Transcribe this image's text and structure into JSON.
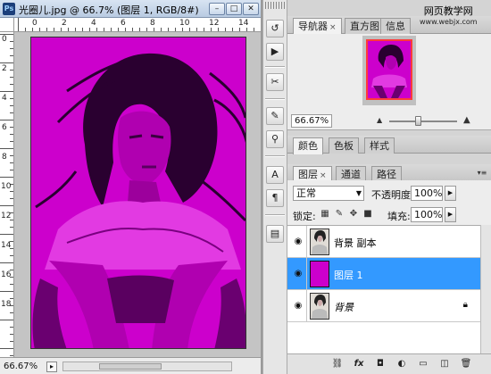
{
  "document": {
    "title": "光圈儿.jpg @ 66.7% (图层 1, RGB/8#)",
    "app_icon": "Ps",
    "zoom": "66.67%",
    "ruler_top": [
      "0",
      "2",
      "4",
      "6",
      "8",
      "10",
      "12",
      "14"
    ],
    "ruler_left": [
      "0",
      "2",
      "4",
      "6",
      "8",
      "10",
      "12",
      "14",
      "16",
      "18"
    ],
    "image_color": "#cc00cc"
  },
  "icons": {
    "minimize": "–",
    "maximize": "□",
    "close": "✕",
    "strip": [
      "history-icon",
      "actions-icon",
      "tool-presets-icon",
      "brushes-icon",
      "clone-source-icon",
      "character-icon",
      "paragraph-icon",
      "layer-comps-icon"
    ]
  },
  "navigator_group": {
    "tabs": [
      "导航器",
      "直方图",
      "信息"
    ],
    "close_mark": "×",
    "zoom_value": "66.67%"
  },
  "color_group": {
    "tabs": [
      "颜色",
      "色板",
      "样式"
    ]
  },
  "layers_group": {
    "tabs": [
      "图层",
      "通道",
      "路径"
    ],
    "close_mark": "×",
    "blend_mode": "正常",
    "opacity_label": "不透明度:",
    "opacity_value": "100%",
    "lock_label": "锁定:",
    "fill_label": "填充:",
    "fill_value": "100%",
    "layers": [
      {
        "name": "背景 副本",
        "visible": true,
        "selected": false,
        "thumb": "photo"
      },
      {
        "name": "图层 1",
        "visible": true,
        "selected": true,
        "thumb": "magenta"
      },
      {
        "name": "背景",
        "visible": true,
        "selected": false,
        "thumb": "photo",
        "locked": true
      }
    ]
  },
  "watermark": {
    "line1": "网页教学网",
    "line2": "www.webjx.com"
  },
  "colors": {
    "accent": "#3399ff",
    "image": "#cc00cc",
    "nav_frame": "#ff3a3a"
  }
}
